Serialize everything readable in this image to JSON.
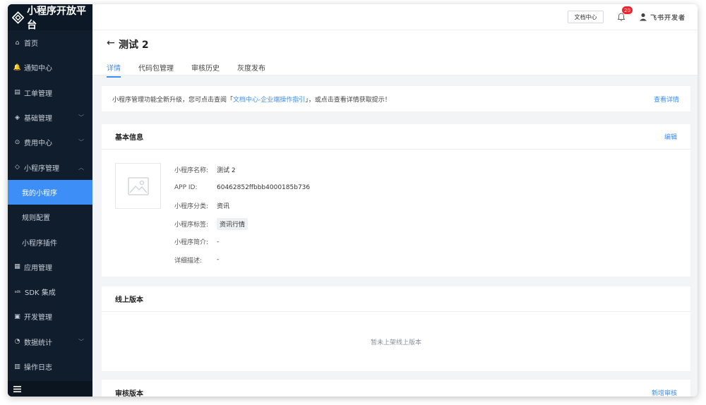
{
  "brand": {
    "title": "小程序开放平台"
  },
  "sidebar": {
    "items": [
      {
        "label": "首页",
        "icon": "home-icon",
        "glyph": "⌂"
      },
      {
        "label": "通知中心",
        "icon": "bell-icon",
        "glyph": "🔔"
      },
      {
        "label": "工单管理",
        "icon": "clipboard-icon",
        "glyph": "▤"
      },
      {
        "label": "基础管理",
        "icon": "layers-icon",
        "glyph": "◈",
        "chevron": "﹀"
      },
      {
        "label": "费用中心",
        "icon": "coin-icon",
        "glyph": "⊙",
        "chevron": "﹀"
      },
      {
        "label": "小程序管理",
        "icon": "diamond-icon",
        "glyph": "◇",
        "chevron": "︿"
      },
      {
        "label": "我的小程序",
        "sub": true,
        "active": true
      },
      {
        "label": "规则配置",
        "sub": true
      },
      {
        "label": "小程序插件",
        "sub": true
      },
      {
        "label": "应用管理",
        "icon": "grid-icon",
        "glyph": "▦"
      },
      {
        "label": "SDK 集成",
        "icon": "sdk-icon",
        "glyph": "sdk"
      },
      {
        "label": "开发管理",
        "icon": "monitor-icon",
        "glyph": "▣"
      },
      {
        "label": "数据统计",
        "icon": "pie-chart-icon",
        "glyph": "◔",
        "chevron": "﹀"
      },
      {
        "label": "操作日志",
        "icon": "log-icon",
        "glyph": "▥"
      }
    ],
    "footer_icon": "menu-icon"
  },
  "topbar": {
    "doc_center": "文档中心",
    "notification_count": "20",
    "user_name": "飞书开发者"
  },
  "page": {
    "back_glyph": "←",
    "title": "测试 2",
    "tabs": [
      {
        "label": "详情",
        "active": true
      },
      {
        "label": "代码包管理"
      },
      {
        "label": "审核历史"
      },
      {
        "label": "灰度发布"
      }
    ]
  },
  "notice": {
    "text_before": "小程序管理功能全新升级，您可点击查阅「",
    "link": "文档中心-企业端操作指引",
    "text_after": "」，或点击查看详情获取提示！",
    "detail_link": "查看详情"
  },
  "basic_info": {
    "title": "基本信息",
    "edit": "编辑",
    "rows": [
      {
        "label": "小程序名称:",
        "value": "测试 2"
      },
      {
        "label": "APP ID:",
        "value": "60462852ffbbb4000185b736"
      },
      {
        "label": "小程序分类:",
        "value": "资讯"
      },
      {
        "label": "小程序标签:",
        "value": "资讯行情",
        "tag": true
      },
      {
        "label": "小程序简介:",
        "value": "-"
      },
      {
        "label": "详细描述:",
        "value": "-"
      }
    ]
  },
  "online_version": {
    "title": "线上版本",
    "empty": "暂未上架线上版本"
  },
  "review_version": {
    "title": "审核版本",
    "action": "新增审核"
  }
}
